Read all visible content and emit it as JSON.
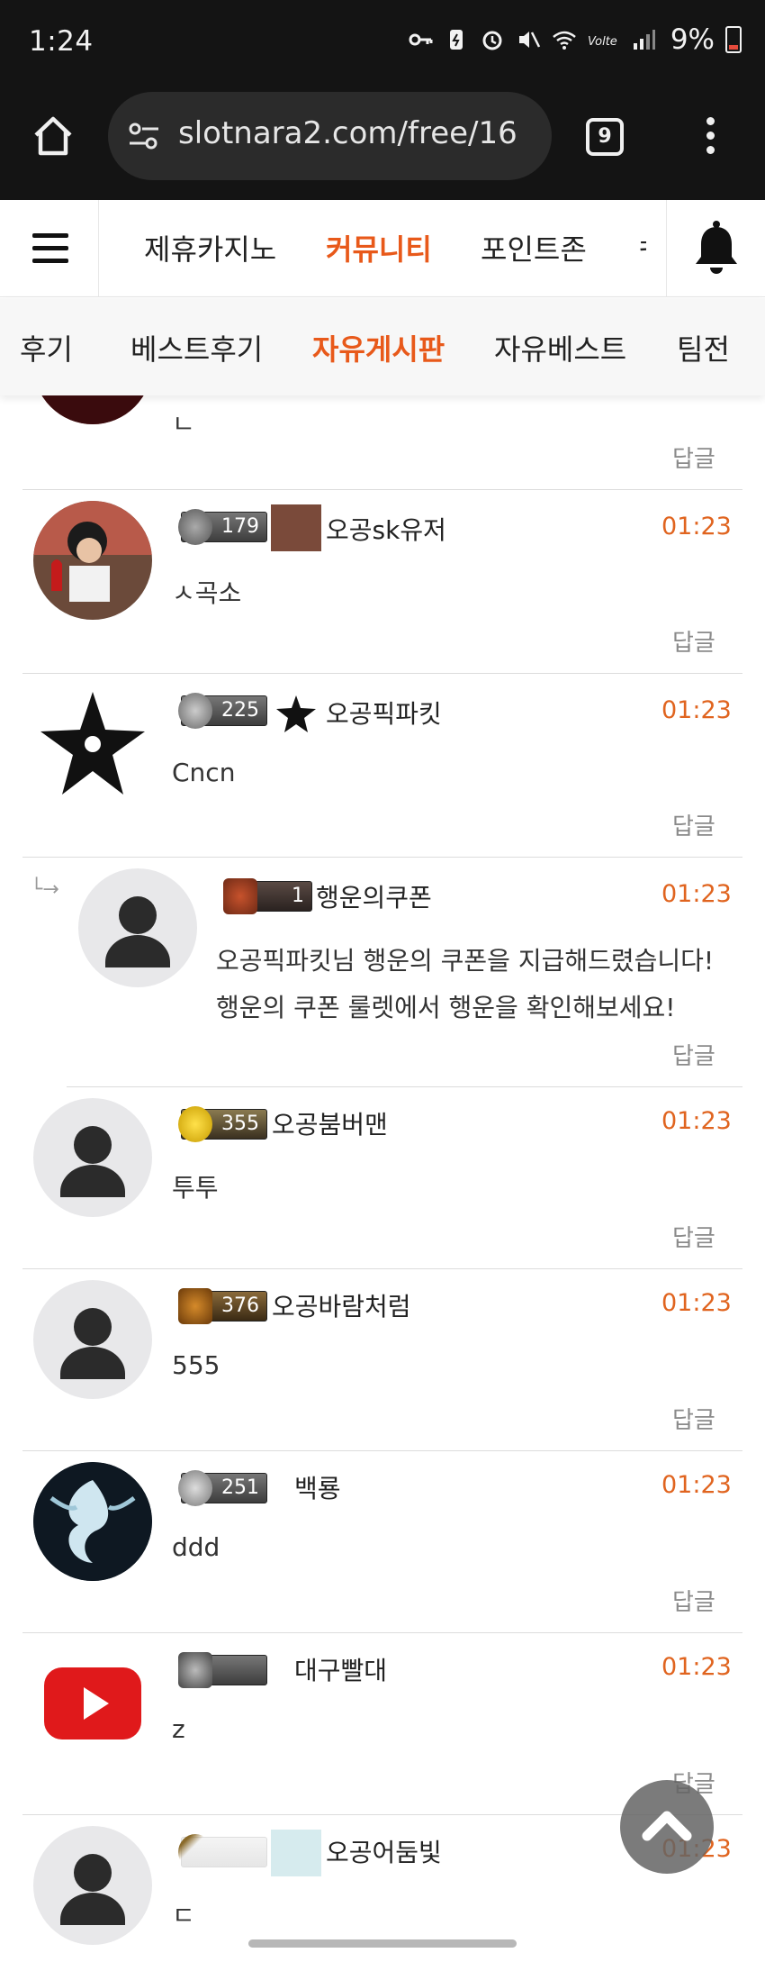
{
  "status_bar": {
    "time": "1:24",
    "battery": "9%"
  },
  "browser": {
    "url": "slotnara2.com/free/16",
    "tab_count": "9"
  },
  "site_nav": {
    "items": [
      "제휴카지노",
      "커뮤니티",
      "포인트존",
      "ㅋ"
    ],
    "active": "커뮤니티"
  },
  "sub_nav": {
    "items": [
      "후기",
      "베스트후기",
      "자유게시판",
      "자유베스트",
      "팀전"
    ],
    "active": "자유게시판"
  },
  "reply_label": "답글",
  "comments": [
    {
      "text": "ㄴ"
    },
    {
      "level": "179",
      "nickname": "오공sk유저",
      "time": "01:23",
      "text": "ㅅ곡소"
    },
    {
      "level": "225",
      "nickname": "오공픽파킷",
      "time": "01:23",
      "text": "Cncn"
    },
    {
      "level": "1",
      "nickname": "행운의쿠폰",
      "time": "01:23",
      "lines": [
        "오공픽파킷님 행운의 쿠폰을 지급해드렸습니다!",
        "행운의 쿠폰 룰렛에서 행운을 확인해보세요!"
      ]
    },
    {
      "level": "355",
      "nickname": "오공붐버맨",
      "time": "01:23",
      "text": "투투"
    },
    {
      "level": "376",
      "nickname": "오공바람처럼",
      "time": "01:23",
      "text": "555"
    },
    {
      "level": "251",
      "nickname": "백룡",
      "time": "01:23",
      "text": "ddd"
    },
    {
      "level": "",
      "nickname": "대구빨대",
      "time": "01:23",
      "text": "z"
    },
    {
      "level": "",
      "nickname": "오공어둠빛",
      "time": "01:23",
      "text": "ㄷ"
    }
  ],
  "colors": {
    "accent": "#e8591a",
    "time": "#e0641f",
    "dark_bar": "#141414"
  }
}
